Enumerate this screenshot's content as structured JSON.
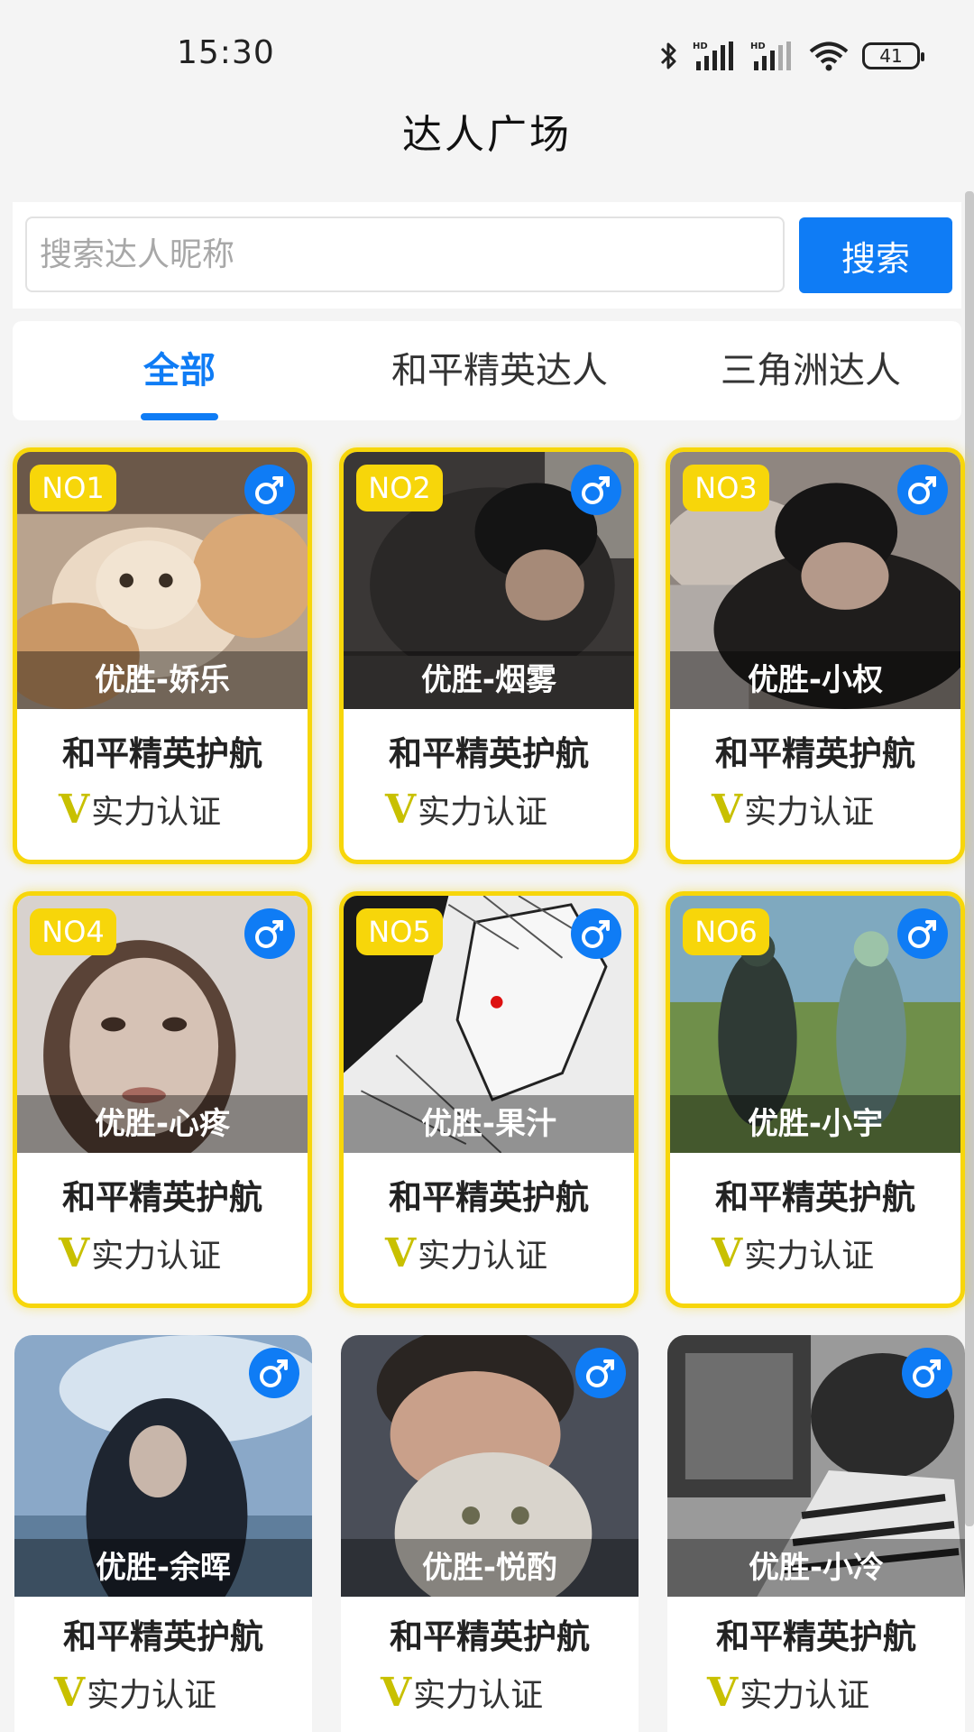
{
  "status_bar": {
    "time": "15:30",
    "battery": "41",
    "icons": [
      "bluetooth-icon",
      "signal-hd-icon",
      "signal-hd-icon",
      "wifi-icon",
      "battery-icon"
    ]
  },
  "page": {
    "title": "达人广场"
  },
  "search": {
    "placeholder": "搜索达人昵称",
    "value": "",
    "button_label": "搜索"
  },
  "tabs": [
    {
      "label": "全部",
      "active": true
    },
    {
      "label": "和平精英达人",
      "active": false
    },
    {
      "label": "三角洲达人",
      "active": false
    }
  ],
  "colors": {
    "accent": "#0f7cf5",
    "rank_gold": "#f7d60a",
    "cert_v": "#c8c000"
  },
  "cards": [
    {
      "rank": "NO1",
      "name": "优胜-娇乐",
      "game": "和平精英护航",
      "cert": "实力认证",
      "gender_icon": "male-icon"
    },
    {
      "rank": "NO2",
      "name": "优胜-烟雾",
      "game": "和平精英护航",
      "cert": "实力认证",
      "gender_icon": "male-icon"
    },
    {
      "rank": "NO3",
      "name": "优胜-小权",
      "game": "和平精英护航",
      "cert": "实力认证",
      "gender_icon": "male-icon"
    },
    {
      "rank": "NO4",
      "name": "优胜-心疼",
      "game": "和平精英护航",
      "cert": "实力认证",
      "gender_icon": "male-icon"
    },
    {
      "rank": "NO5",
      "name": "优胜-果汁",
      "game": "和平精英护航",
      "cert": "实力认证",
      "gender_icon": "male-icon"
    },
    {
      "rank": "NO6",
      "name": "优胜-小宇",
      "game": "和平精英护航",
      "cert": "实力认证",
      "gender_icon": "male-icon"
    },
    {
      "rank": "",
      "name": "优胜-余晖",
      "game": "和平精英护航",
      "cert": "实力认证",
      "gender_icon": "male-icon"
    },
    {
      "rank": "",
      "name": "优胜-悦酌",
      "game": "和平精英护航",
      "cert": "实力认证",
      "gender_icon": "male-icon"
    },
    {
      "rank": "",
      "name": "优胜-小冷",
      "game": "和平精英护航",
      "cert": "实力认证",
      "gender_icon": "male-icon"
    }
  ]
}
